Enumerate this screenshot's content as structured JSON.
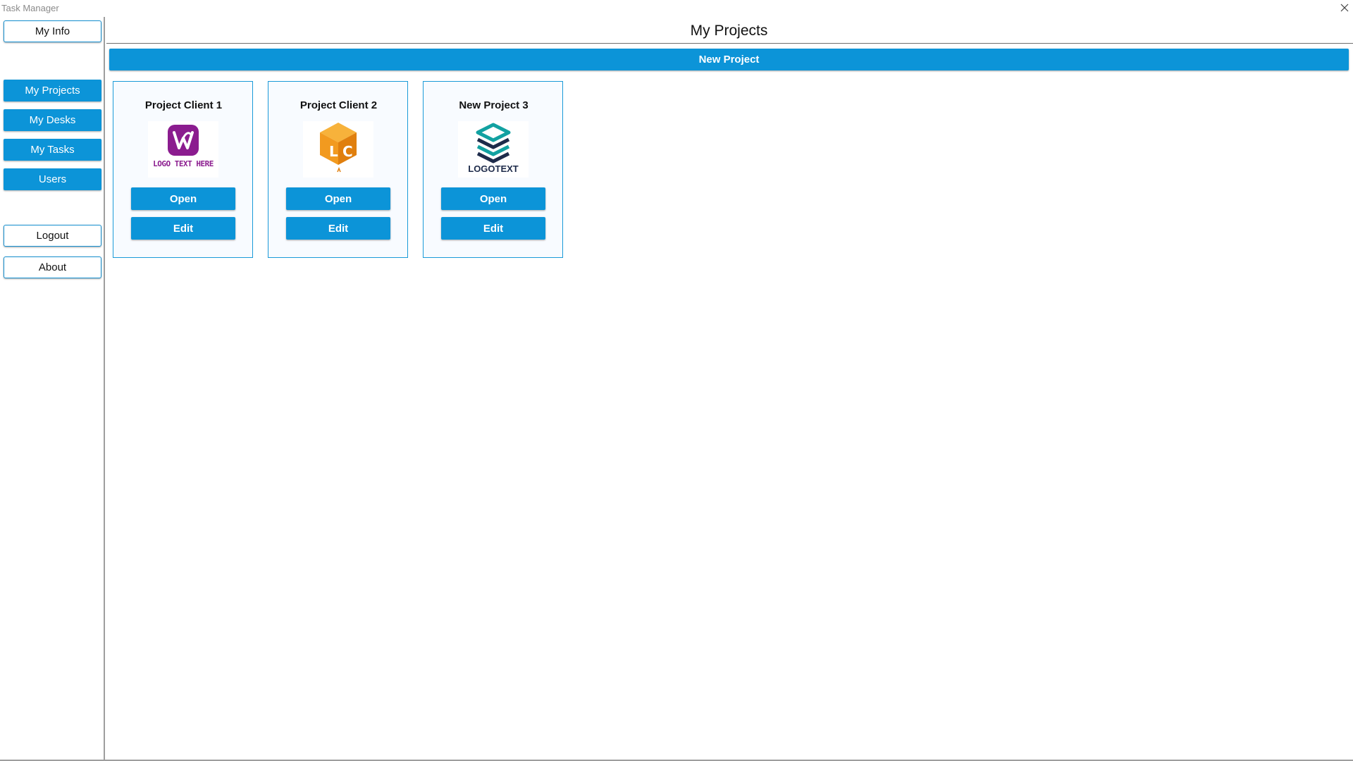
{
  "window": {
    "title": "Task Manager",
    "close_icon": "close-icon"
  },
  "sidebar": {
    "my_info": "My Info",
    "nav": [
      {
        "label": "My Projects"
      },
      {
        "label": "My Desks"
      },
      {
        "label": "My Tasks"
      },
      {
        "label": "Users"
      }
    ],
    "logout": "Logout",
    "about": "About"
  },
  "main": {
    "title": "My Projects",
    "new_project": "New Project",
    "projects": [
      {
        "name": "Project Client 1",
        "logo": {
          "text": "LOGO TEXT HERE",
          "icon": "w-letter-logo-icon",
          "color": "#8b1c8f"
        },
        "open": "Open",
        "edit": "Edit"
      },
      {
        "name": "Project Client 2",
        "logo": {
          "text": "",
          "icon": "lc-cube-logo-icon",
          "color": "#f29a1f"
        },
        "open": "Open",
        "edit": "Edit"
      },
      {
        "name": "New Project 3",
        "logo": {
          "text": "LOGOTEXT",
          "icon": "stacked-layers-logo-icon",
          "color": "#12a1a1"
        },
        "open": "Open",
        "edit": "Edit"
      }
    ]
  },
  "colors": {
    "accent": "#0c94d8",
    "card_border": "#1a9ad8",
    "sidebar_border": "#9e9e9e"
  }
}
